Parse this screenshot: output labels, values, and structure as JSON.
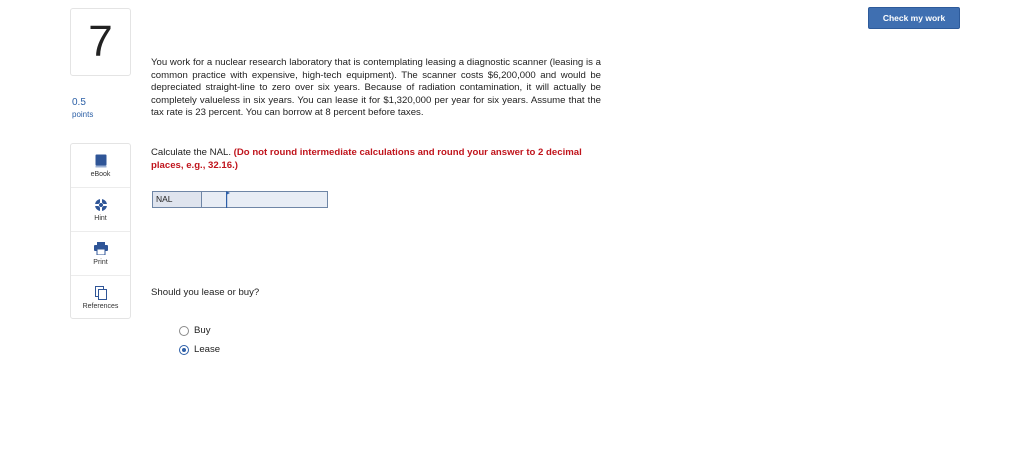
{
  "question_number": "7",
  "points": {
    "value": "0.5",
    "label": "points"
  },
  "sidebar": {
    "items": [
      {
        "label": "eBook",
        "icon": "book-icon"
      },
      {
        "label": "Hint",
        "icon": "lifebuoy-icon"
      },
      {
        "label": "Print",
        "icon": "printer-icon"
      },
      {
        "label": "References",
        "icon": "references-icon"
      }
    ]
  },
  "header": {
    "check_button": "Check my work"
  },
  "question": {
    "text": "You work for a nuclear research laboratory that is contemplating leasing a diagnostic scanner (leasing is a common practice with expensive, high-tech equipment). The scanner costs $6,200,000 and would be depreciated straight-line to zero over six years. Because of radiation contamination, it will actually be completely valueless in six years. You can lease it for $1,320,000 per year for six years. Assume that the tax rate is 23 percent. You can borrow at 8 percent before taxes.",
    "instruction": "Calculate the NAL.",
    "instruction_note": "(Do not round intermediate calculations and round your answer to 2 decimal places, e.g., 32.16.)"
  },
  "nal": {
    "label": "NAL",
    "value": ""
  },
  "question2": {
    "text": "Should you lease or buy?",
    "options": [
      {
        "label": "Buy",
        "selected": false
      },
      {
        "label": "Lease",
        "selected": true
      }
    ]
  },
  "colors": {
    "accent": "#3f6fb1",
    "warning_text": "#c0141c",
    "link": "#2b5fa6"
  }
}
